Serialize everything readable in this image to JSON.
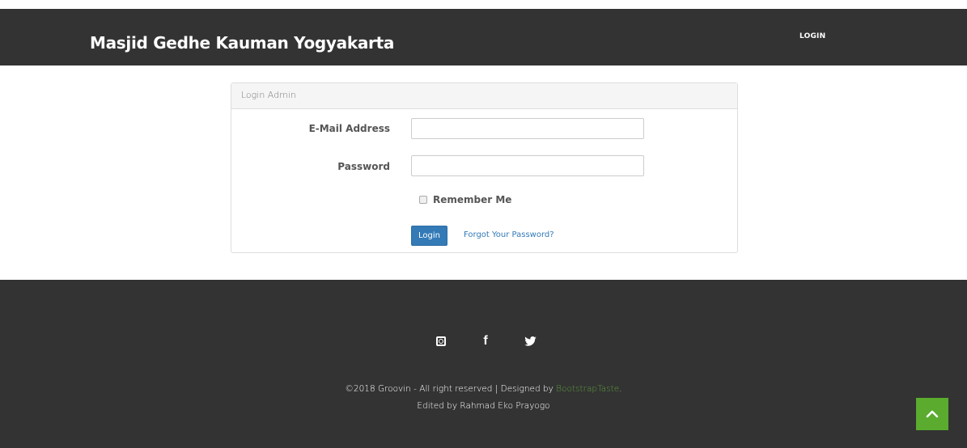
{
  "header": {
    "brand": "Masjid Gedhe Kauman Yogyakarta",
    "nav_login": "LOGIN"
  },
  "login_panel": {
    "heading": "Login Admin",
    "email_label": "E-Mail Address",
    "email_value": "",
    "password_label": "Password",
    "password_value": "",
    "remember_label": "Remember Me",
    "remember_checked": false,
    "login_button": "Login",
    "forgot_link": "Forgot Your Password?"
  },
  "footer": {
    "social": [
      "instagram-icon",
      "facebook-icon",
      "twitter-icon"
    ],
    "copyright_prefix": "©2018 Groovin - All right reserved | Designed by ",
    "designer_link": "BootstrapTaste",
    "copyright_suffix": ".",
    "edited_by": "Edited by Rahmad Eko Prayogo"
  },
  "colors": {
    "navbar_bg": "#333333",
    "footer_bg": "#333333",
    "primary": "#337ab7",
    "accent_green": "#5aab2e"
  }
}
